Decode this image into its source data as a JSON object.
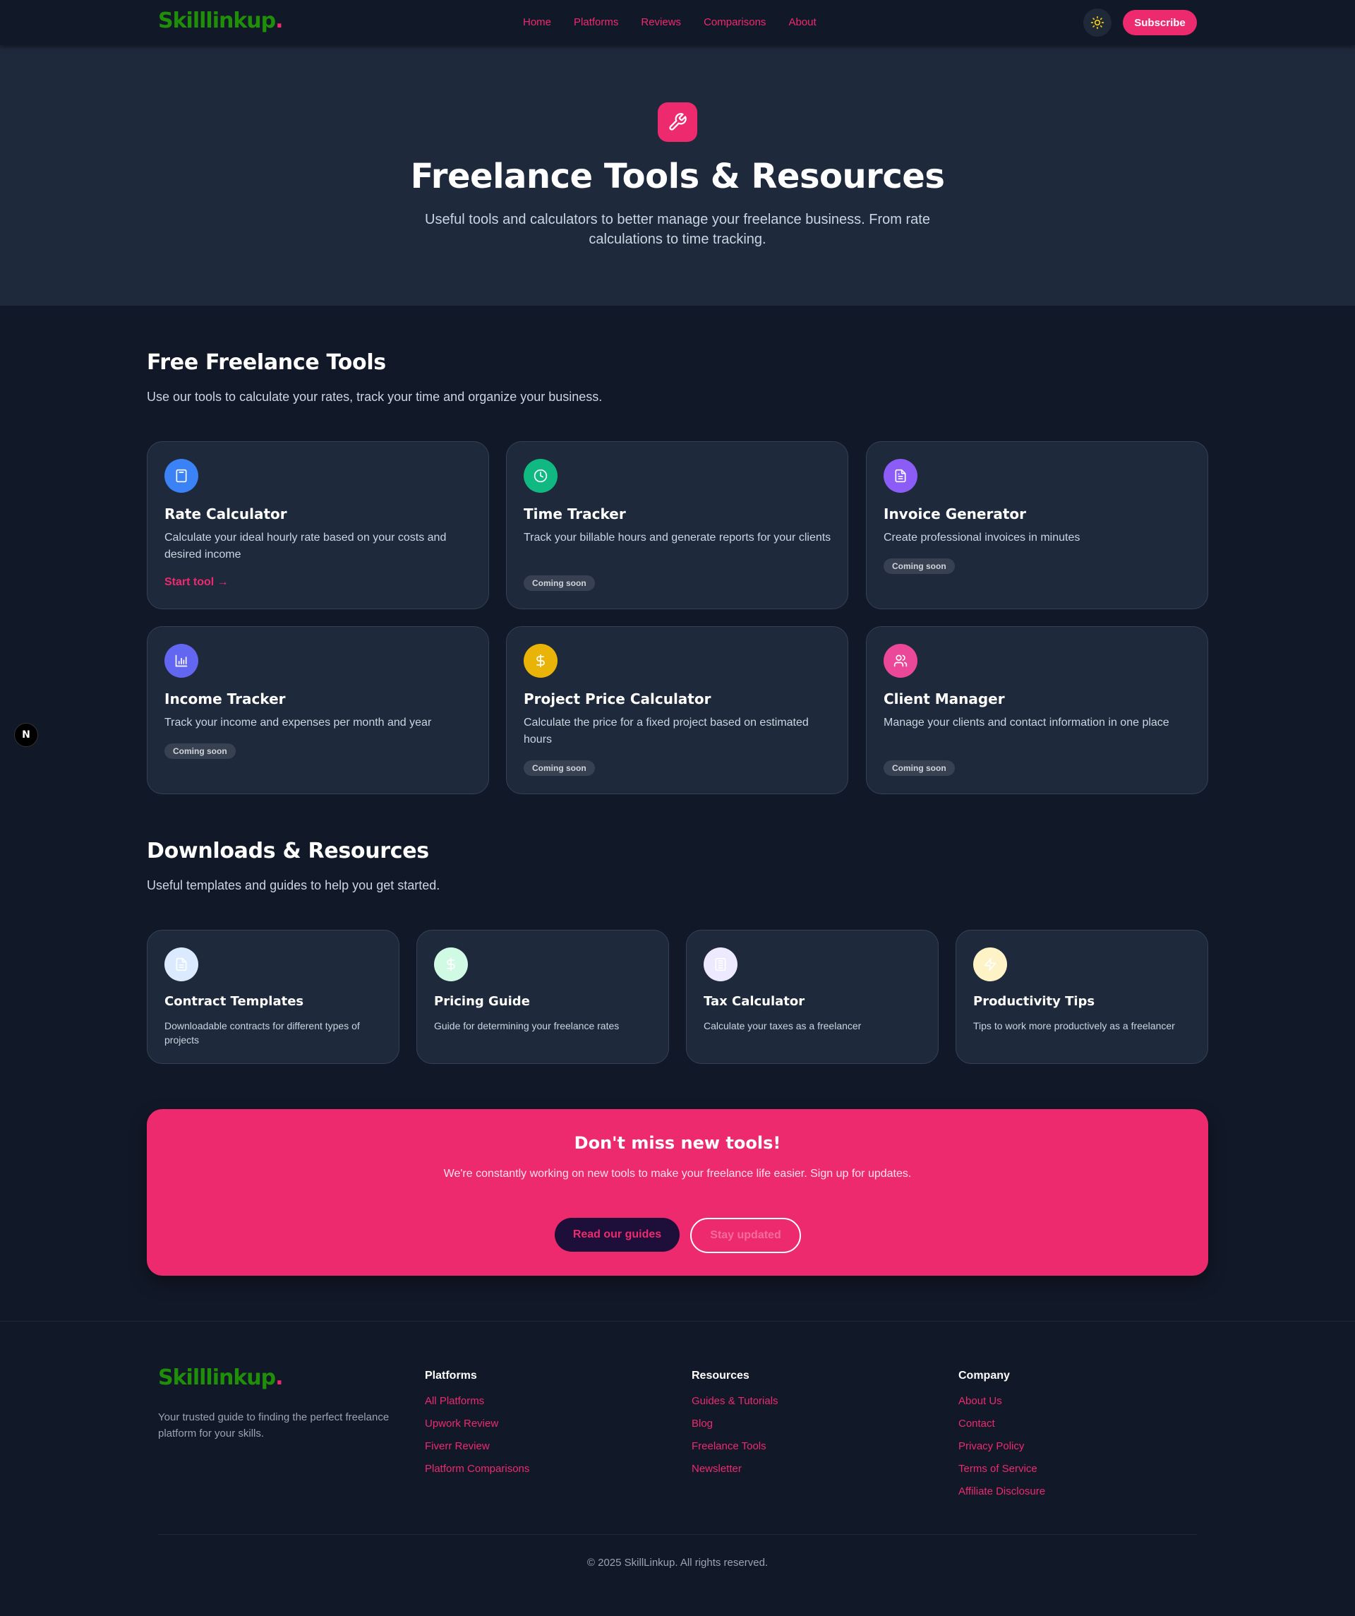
{
  "colors": {
    "accent": "#ee2a6f",
    "brand_green": "#1f8f0a",
    "bg": "#111827",
    "card": "#1e293b"
  },
  "header": {
    "logo_text": "Skilllinkup",
    "logo_dot": ".",
    "nav": [
      "Home",
      "Platforms",
      "Reviews",
      "Comparisons",
      "About"
    ],
    "theme_icon": "sun-icon",
    "subscribe_label": "Subscribe"
  },
  "hero": {
    "icon": "wrench-icon",
    "title": "Freelance Tools & Resources",
    "subtitle": "Useful tools and calculators to better manage your freelance business. From rate calculations to time tracking."
  },
  "tools_section": {
    "title": "Free Freelance Tools",
    "subtitle": "Use our tools to calculate your rates, track your time and organize your business.",
    "cards": [
      {
        "title": "Rate Calculator",
        "desc": "Calculate your ideal hourly rate based on your costs and desired income",
        "link": "Start tool →",
        "icon": "calculator-icon",
        "color": "#3b82f6"
      },
      {
        "title": "Time Tracker",
        "desc": "Track your billable hours and generate reports for your clients",
        "badge": "Coming soon",
        "icon": "clock-icon",
        "color": "#10b981"
      },
      {
        "title": "Invoice Generator",
        "desc": "Create professional invoices in minutes",
        "badge": "Coming soon",
        "icon": "document-icon",
        "color": "#8b5cf6"
      },
      {
        "title": "Income Tracker",
        "desc": "Track your income and expenses per month and year",
        "badge": "Coming soon",
        "icon": "bar-chart-icon",
        "color": "#6366f1"
      },
      {
        "title": "Project Price Calculator",
        "desc": "Calculate the price for a fixed project based on estimated hours",
        "badge": "Coming soon",
        "icon": "dollar-icon",
        "color": "#eab308"
      },
      {
        "title": "Client Manager",
        "desc": "Manage your clients and contact information in one place",
        "badge": "Coming soon",
        "icon": "users-icon",
        "color": "#ec4899"
      }
    ]
  },
  "resources_section": {
    "title": "Downloads & Resources",
    "subtitle": "Useful templates and guides to help you get started.",
    "cards": [
      {
        "title": "Contract Templates",
        "desc": "Downloadable contracts for different types of projects",
        "icon": "document-icon",
        "color": "#dbeafe"
      },
      {
        "title": "Pricing Guide",
        "desc": "Guide for determining your freelance rates",
        "icon": "dollar-icon",
        "color": "#d1fae5"
      },
      {
        "title": "Tax Calculator",
        "desc": "Calculate your taxes as a freelancer",
        "icon": "calculator-icon",
        "color": "#ede9fe"
      },
      {
        "title": "Productivity Tips",
        "desc": "Tips to work more productively as a freelancer",
        "icon": "lightning-icon",
        "color": "#fef3c7"
      }
    ]
  },
  "cta": {
    "title": "Don't miss new tools!",
    "subtitle": "We're constantly working on new tools to make your freelance life easier. Sign up for updates.",
    "primary_label": "Read our guides",
    "secondary_label": "Stay updated"
  },
  "footer": {
    "logo_text": "Skilllinkup",
    "logo_dot": ".",
    "tagline": "Your trusted guide to finding the perfect freelance platform for your skills.",
    "columns": [
      {
        "title": "Platforms",
        "links": [
          "All Platforms",
          "Upwork Review",
          "Fiverr Review",
          "Platform Comparisons"
        ]
      },
      {
        "title": "Resources",
        "links": [
          "Guides & Tutorials",
          "Blog",
          "Freelance Tools",
          "Newsletter"
        ]
      },
      {
        "title": "Company",
        "links": [
          "About Us",
          "Contact",
          "Privacy Policy",
          "Terms of Service",
          "Affiliate Disclosure"
        ]
      }
    ],
    "copyright": "© 2025 SkillLinkup. All rights reserved."
  },
  "floating_badge": {
    "letter": "N",
    "icon": "nextjs-icon"
  }
}
